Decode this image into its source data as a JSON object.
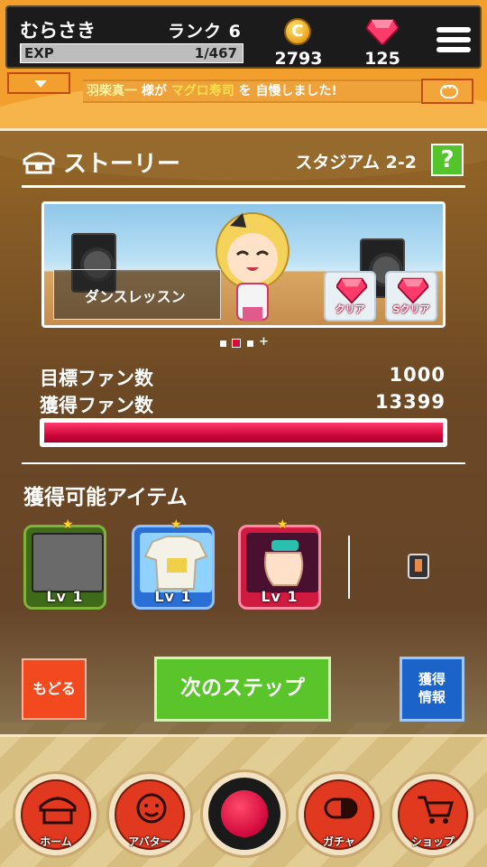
{
  "header": {
    "player_name": "むらさき",
    "rank": "ランク 6",
    "exp_label": "EXP",
    "exp_value": "1/467",
    "exp_progress": 0.002,
    "coins": "2793",
    "coin_symbol": "C",
    "gems": "125"
  },
  "ticker": {
    "user": "羽柴真一",
    "mid1": " 様が ",
    "item": "マグロ寿司",
    "mid2": " を 自慢しました!"
  },
  "story": {
    "title": "ストーリー",
    "stage": "スタジアム 2-2",
    "help_label": "?",
    "lesson_name": "ダンスレッスン",
    "reward_clear": "クリア",
    "reward_s_clear": "Sクリア",
    "pager_plus": "+",
    "target_fans_label": "目標ファン数",
    "target_fans_value": "1000",
    "earned_fans_label": "獲得ファン数",
    "earned_fans_value": "13399",
    "fan_progress": 1.0
  },
  "items": {
    "title": "獲得可能アイテム",
    "list": [
      {
        "level": "Lv 1",
        "frame_color": "#3f6a1a",
        "icon": "blank-item-icon"
      },
      {
        "level": "Lv 1",
        "frame_color": "#2a6fd6",
        "icon": "jersey-icon"
      },
      {
        "level": "Lv 1",
        "frame_color": "#d11a3f",
        "icon": "glove-icon"
      }
    ]
  },
  "actions": {
    "back": "もどる",
    "next": "次のステップ",
    "info_line1": "獲得",
    "info_line2": "情報"
  },
  "nav": {
    "home": "ホーム",
    "avatar": "アバター",
    "gacha": "ガチャ",
    "shop": "ショップ"
  },
  "colors": {
    "accent_orange": "#f29f2e",
    "accent_green": "#59c52a",
    "accent_red": "#f24a1e",
    "accent_blue": "#1b63c9",
    "fan_bar": "#d1083c"
  }
}
